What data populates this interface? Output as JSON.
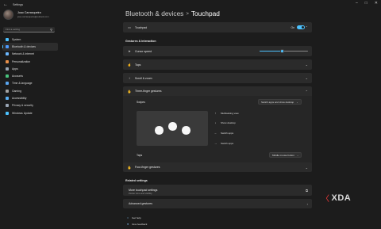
{
  "window": {
    "title": "Settings",
    "back_icon": "back-arrow-icon",
    "controls": [
      "minimize-icon",
      "maximize-icon",
      "close-icon"
    ]
  },
  "profile": {
    "name": "Joao Carrasqueira",
    "email": "joao.carrasqueira@outlook.com"
  },
  "search": {
    "placeholder": "Find a setting"
  },
  "sidebar": {
    "items": [
      {
        "label": "System",
        "icon": "monitor-icon",
        "color": "#4cc2ff"
      },
      {
        "label": "Bluetooth & devices",
        "icon": "bluetooth-icon",
        "color": "#4c9aff"
      },
      {
        "label": "Network & internet",
        "icon": "wifi-icon",
        "color": "#6cb8ff"
      },
      {
        "label": "Personalization",
        "icon": "brush-icon",
        "color": "#e88f4a"
      },
      {
        "label": "Apps",
        "icon": "apps-icon",
        "color": "#9aa6b5"
      },
      {
        "label": "Accounts",
        "icon": "person-icon",
        "color": "#48c57e"
      },
      {
        "label": "Time & language",
        "icon": "globe-clock-icon",
        "color": "#5aa6f0"
      },
      {
        "label": "Gaming",
        "icon": "gamepad-icon",
        "color": "#a3a3a3"
      },
      {
        "label": "Accessibility",
        "icon": "accessibility-icon",
        "color": "#5ab0f5"
      },
      {
        "label": "Privacy & security",
        "icon": "shield-icon",
        "color": "#9aa6b5"
      },
      {
        "label": "Windows Update",
        "icon": "update-icon",
        "color": "#4cc2ff"
      }
    ],
    "active_index": 1
  },
  "breadcrumb": {
    "parent": "Bluetooth & devices",
    "separator": ">",
    "current": "Touchpad"
  },
  "touchpad": {
    "label": "Touchpad",
    "toggle_state": "On"
  },
  "gestures_section": "Gestures & interaction",
  "cursor_speed": {
    "label": "Cursor speed",
    "value_fraction": 0.47
  },
  "taps": {
    "label": "Taps"
  },
  "scroll_zoom": {
    "label": "Scroll & zoom"
  },
  "three_finger": {
    "label": "Three-finger gestures",
    "swipes_label": "Swipes",
    "swipes_value": "Switch apps and show desktop",
    "gestures": [
      {
        "label": "Multitasking view",
        "icon": "arrow-up-icon"
      },
      {
        "label": "Show desktop",
        "icon": "arrow-down-icon"
      },
      {
        "label": "Switch apps",
        "icon": "arrow-left-icon"
      },
      {
        "label": "Switch apps",
        "icon": "arrow-right-icon"
      }
    ],
    "taps_label": "Taps",
    "taps_value": "Middle mouse button"
  },
  "four_finger": {
    "label": "Four-finger gestures"
  },
  "related_section": "Related settings",
  "related": [
    {
      "label": "More touchpad settings",
      "sublabel": "Pointer icons and visibility"
    },
    {
      "label": "Advanced gestures"
    }
  ],
  "help": [
    {
      "label": "Get help"
    },
    {
      "label": "Give feedback"
    }
  ],
  "watermark": {
    "mark": "〈",
    "text": "XDA"
  },
  "accent": "#4cc2ff"
}
